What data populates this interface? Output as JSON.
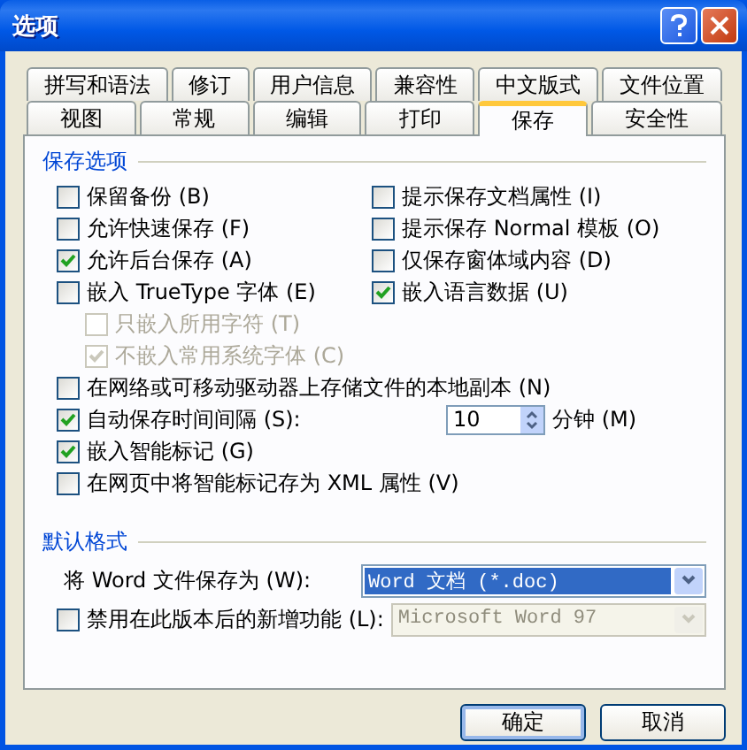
{
  "window": {
    "title": "选项"
  },
  "tab_rows": [
    {
      "tabs": [
        {
          "label": "拼写和语法",
          "selected": false
        },
        {
          "label": "修订",
          "selected": false
        },
        {
          "label": "用户信息",
          "selected": false
        },
        {
          "label": "兼容性",
          "selected": false
        },
        {
          "label": "中文版式",
          "selected": false
        },
        {
          "label": "文件位置",
          "selected": false
        }
      ]
    },
    {
      "tabs": [
        {
          "label": "视图",
          "selected": false
        },
        {
          "label": "常规",
          "selected": false
        },
        {
          "label": "编辑",
          "selected": false
        },
        {
          "label": "打印",
          "selected": false
        },
        {
          "label": "保存",
          "selected": true
        },
        {
          "label": "安全性",
          "selected": false
        }
      ]
    }
  ],
  "save_options": {
    "title": "保存选项",
    "grid": [
      {
        "label": "保留备份 (B)",
        "checked": false
      },
      {
        "label": "提示保存文档属性 (I)",
        "checked": false
      },
      {
        "label": "允许快速保存 (F)",
        "checked": false
      },
      {
        "label": "提示保存 Normal 模板 (O)",
        "checked": false
      },
      {
        "label": "允许后台保存 (A)",
        "checked": true
      },
      {
        "label": "仅保存窗体域内容 (D)",
        "checked": false
      },
      {
        "label": "嵌入 TrueType 字体 (E)",
        "checked": false
      },
      {
        "label": "嵌入语言数据 (U)",
        "checked": true
      }
    ],
    "sub_options": [
      {
        "label": "只嵌入所用字符 (T)",
        "checked": false,
        "disabled": true
      },
      {
        "label": "不嵌入常用系统字体 (C)",
        "checked": true,
        "disabled": true
      }
    ],
    "more": [
      {
        "kind": "check",
        "label": "在网络或可移动驱动器上存储文件的本地副本 (N)",
        "checked": false
      },
      {
        "kind": "spin",
        "label": "自动保存时间间隔 (S):",
        "checked": true,
        "value": "10",
        "unit": "分钟 (M)"
      },
      {
        "kind": "check",
        "label": "嵌入智能标记 (G)",
        "checked": true
      },
      {
        "kind": "check",
        "label": "在网页中将智能标记存为 XML 属性 (V)",
        "checked": false
      }
    ]
  },
  "default_format": {
    "title": "默认格式",
    "save_as": {
      "label": "将 Word 文件保存为 (W):",
      "value": "Word 文档 (*.doc)",
      "selected": true
    },
    "disable_features": {
      "label": "禁用在此版本后的新增功能 (L):",
      "checked": false,
      "value": "Microsoft Word 97",
      "disabled": true
    }
  },
  "buttons": [
    {
      "label": "确定",
      "default": true
    },
    {
      "label": "取消",
      "default": false
    }
  ]
}
